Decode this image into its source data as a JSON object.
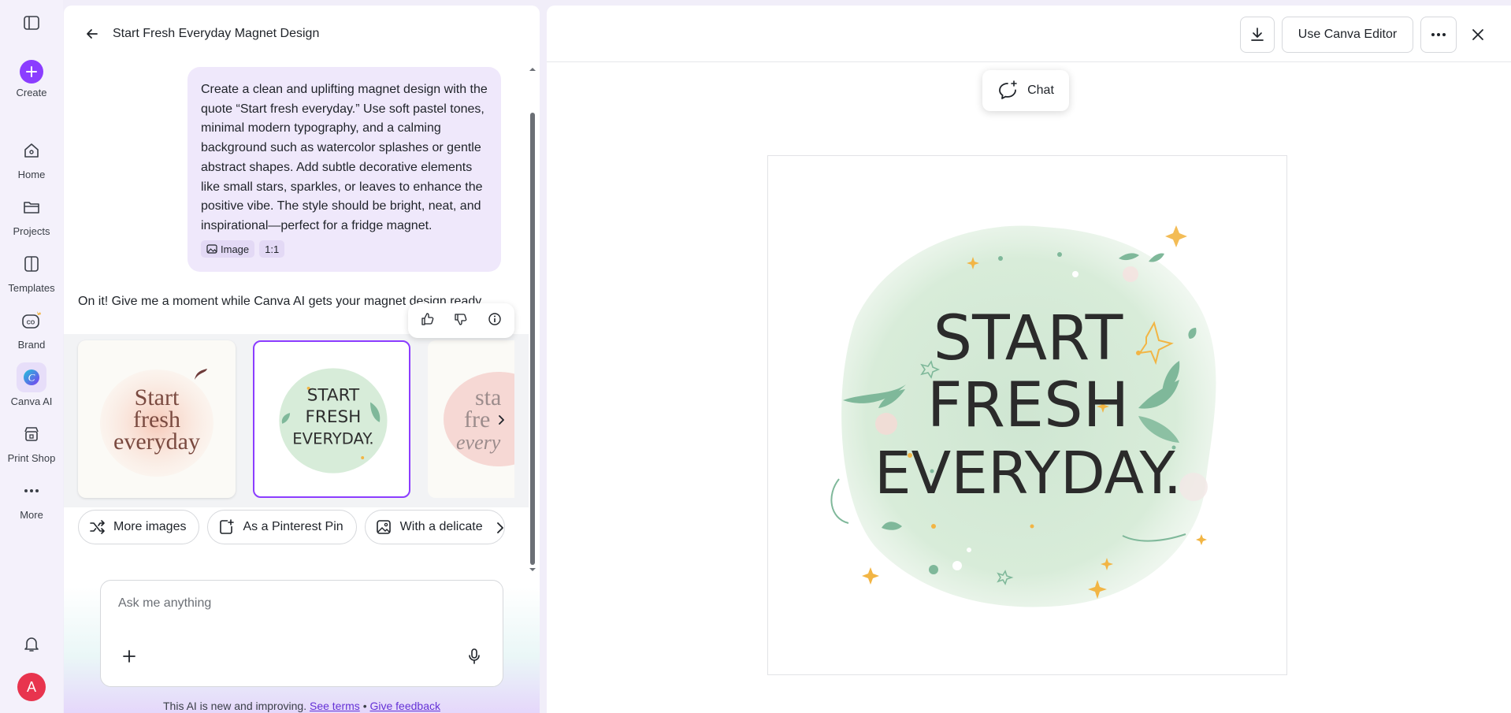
{
  "rail": {
    "items": [
      {
        "label": "Create"
      },
      {
        "label": "Home"
      },
      {
        "label": "Projects"
      },
      {
        "label": "Templates"
      },
      {
        "label": "Brand"
      },
      {
        "label": "Canva AI"
      },
      {
        "label": "Print Shop"
      },
      {
        "label": "More"
      }
    ],
    "avatar_initial": "A"
  },
  "chat": {
    "title": "Start Fresh Everyday Magnet Design",
    "user_prompt": "Create a clean and uplifting magnet design with the quote “Start fresh everyday.” Use soft pastel tones, minimal modern typography, and a calming background such as watercolor splashes or gentle abstract shapes. Add subtle decorative elements like small stars, sparkles, or leaves to enhance the positive vibe. The style should be bright, neat, and inspirational—perfect for a fridge magnet.",
    "chips": [
      "Image",
      "1:1"
    ],
    "ai_reply": "On it! Give me a moment while Canva AI gets your magnet design ready.",
    "thumbnails": [
      {
        "text_lines": [
          "Start",
          "fresh",
          "everyday"
        ]
      },
      {
        "text_lines": [
          "START",
          "FRESH",
          "EVERYDAY."
        ]
      },
      {
        "text_lines": [
          "sta",
          "fre",
          "every"
        ]
      }
    ],
    "suggestions": [
      {
        "label": "More images"
      },
      {
        "label": "As a Pinterest Pin"
      },
      {
        "label": "With a delicate"
      }
    ],
    "input_placeholder": "Ask me anything",
    "disclaimer": {
      "text": "This AI is new and improving.",
      "terms": "See terms",
      "separator": "•",
      "feedback": "Give feedback"
    }
  },
  "preview": {
    "use_editor_label": "Use Canva Editor",
    "chat_pill_label": "Chat",
    "design_lines": [
      "START",
      "FRESH",
      "EVERYDAY."
    ]
  },
  "colors": {
    "accent": "#8b3dff",
    "mint": "#d7ecd9",
    "leaf": "#7fb89a",
    "star": "#f2b544"
  }
}
